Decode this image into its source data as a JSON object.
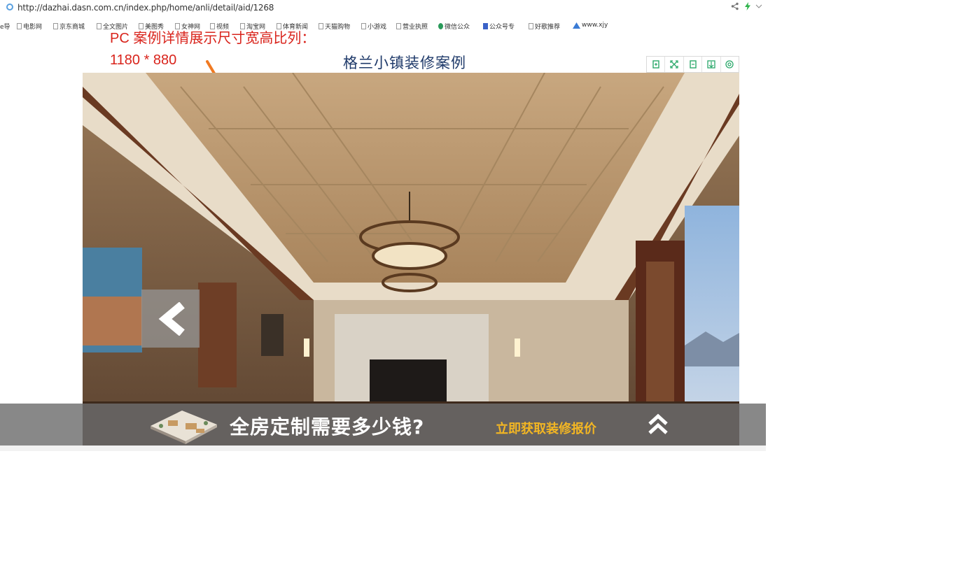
{
  "browser": {
    "url": "http://dazhai.dasn.com.cn/index.php/home/anli/detail/aid/1268",
    "share_icon": "share-icon",
    "bolt_icon": "lightning-icon",
    "dropdown_icon": "chevron-down-icon"
  },
  "bookmarks": [
    {
      "label": "e导",
      "icon": "page"
    },
    {
      "label": "电影网",
      "icon": "page"
    },
    {
      "label": "京东商城",
      "icon": "page"
    },
    {
      "label": "全文图片",
      "icon": "page"
    },
    {
      "label": "美图秀",
      "icon": "page"
    },
    {
      "label": "女神网",
      "icon": "page"
    },
    {
      "label": "视频",
      "icon": "page"
    },
    {
      "label": "淘宝网",
      "icon": "page"
    },
    {
      "label": "体育新闻",
      "icon": "page"
    },
    {
      "label": "天猫购物",
      "icon": "page"
    },
    {
      "label": "小游戏",
      "icon": "page"
    },
    {
      "label": "营业执照",
      "icon": "page"
    },
    {
      "label": "微信公众",
      "icon": "globe"
    },
    {
      "label": "公众号专",
      "icon": "paw"
    },
    {
      "label": "好歌推荐",
      "icon": "page"
    },
    {
      "label": "www.xjy",
      "icon": "triangle"
    }
  ],
  "annotation": {
    "line1": "PC 案例详情展示尺寸宽高比列：",
    "line2": "1180 * 880"
  },
  "case_title": "格兰小镇装修案例",
  "toolbar": [
    {
      "icon": "rotate-left-icon"
    },
    {
      "icon": "fullscreen-icon"
    },
    {
      "icon": "rotate-right-icon"
    },
    {
      "icon": "download-icon"
    },
    {
      "icon": "settings-icon"
    }
  ],
  "gallery": {
    "prev_icon": "chevron-left-icon"
  },
  "banner": {
    "headline": "全房定制需要多少钱?",
    "cta": "立即获取装修报价",
    "up_icon": "double-chevron-up-icon"
  },
  "colors": {
    "annotation_red": "#d9241c",
    "title_blue": "#1f3a6a",
    "cta_yellow": "#f3b623",
    "arrow_orange": "#f07a22"
  }
}
